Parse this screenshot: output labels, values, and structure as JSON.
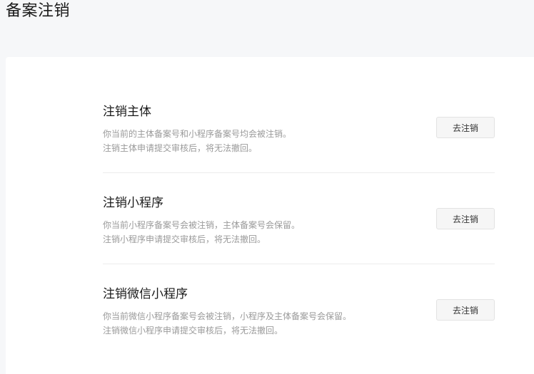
{
  "page": {
    "title": "备案注销"
  },
  "options": [
    {
      "title": "注销主体",
      "desc_line1": "你当前的主体备案号和小程序备案号均会被注销。",
      "desc_line2": "注销主体申请提交审核后，将无法撤回。",
      "button_label": "去注销"
    },
    {
      "title": "注销小程序",
      "desc_line1": "你当前小程序备案号会被注销，主体备案号会保留。",
      "desc_line2": "注销小程序申请提交审核后，将无法撤回。",
      "button_label": "去注销"
    },
    {
      "title": "注销微信小程序",
      "desc_line1": "你当前微信小程序备案号会被注销，小程序及主体备案号会保留。",
      "desc_line2": "注销微信小程序申请提交审核后，将无法撤回。",
      "button_label": "去注销"
    }
  ]
}
